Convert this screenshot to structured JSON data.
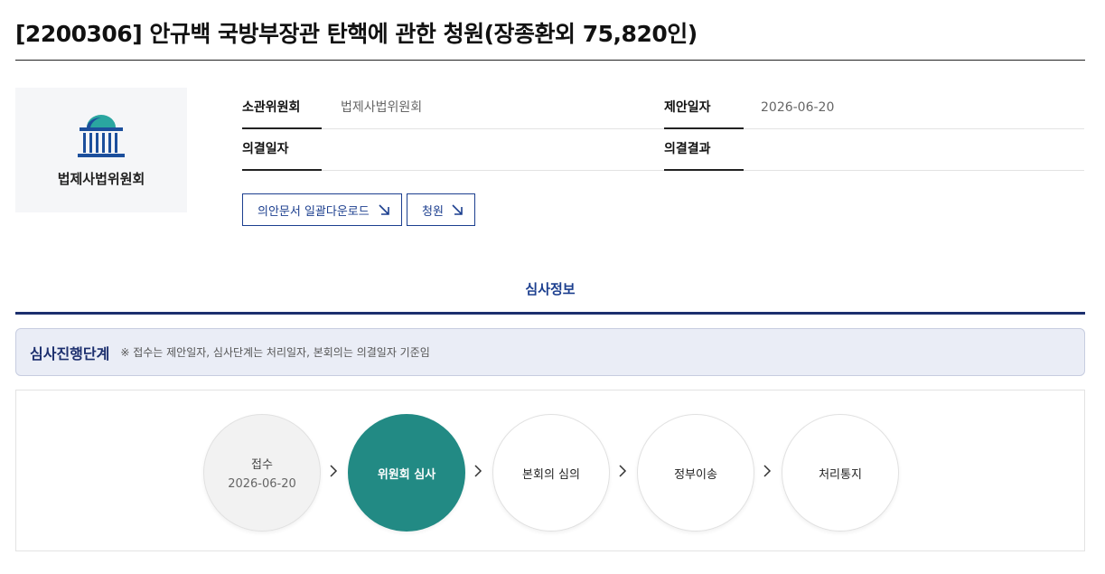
{
  "page": {
    "title": "[2200306] 안규백 국방부장관 탄핵에 관한 청원(장종환외 75,820인)"
  },
  "committee": {
    "name": "법제사법위원회",
    "logo_icon": "national-assembly-icon",
    "logo_color": "#1c4f9c",
    "logo_accent": "#2aa6a0"
  },
  "info": {
    "committee_label": "소관위원회",
    "committee_value": "법제사법위원회",
    "proposal_date_label": "제안일자",
    "proposal_date_value": "2026-06-20",
    "resolution_date_label": "의결일자",
    "resolution_date_value": "",
    "resolution_result_label": "의결결과",
    "resolution_result_value": ""
  },
  "buttons": {
    "download_label": "의안문서 일괄다운로드",
    "petition_label": "청원",
    "arrow_icon": "arrow-down-right-icon"
  },
  "tabs": {
    "review_label": "심사정보"
  },
  "stages": {
    "title": "심사진행단계",
    "note": "※ 접수는 제안일자, 심사단계는 처리일자, 본회의는 의결일자 기준임",
    "steps": [
      {
        "label": "접수",
        "date": "2026-06-20",
        "state": "done"
      },
      {
        "label": "위원회 심사",
        "date": "",
        "state": "active"
      },
      {
        "label": "본회의 심의",
        "date": "",
        "state": "pending"
      },
      {
        "label": "정부이송",
        "date": "",
        "state": "pending"
      },
      {
        "label": "처리통지",
        "date": "",
        "state": "pending"
      }
    ],
    "active_color": "#228a84"
  }
}
